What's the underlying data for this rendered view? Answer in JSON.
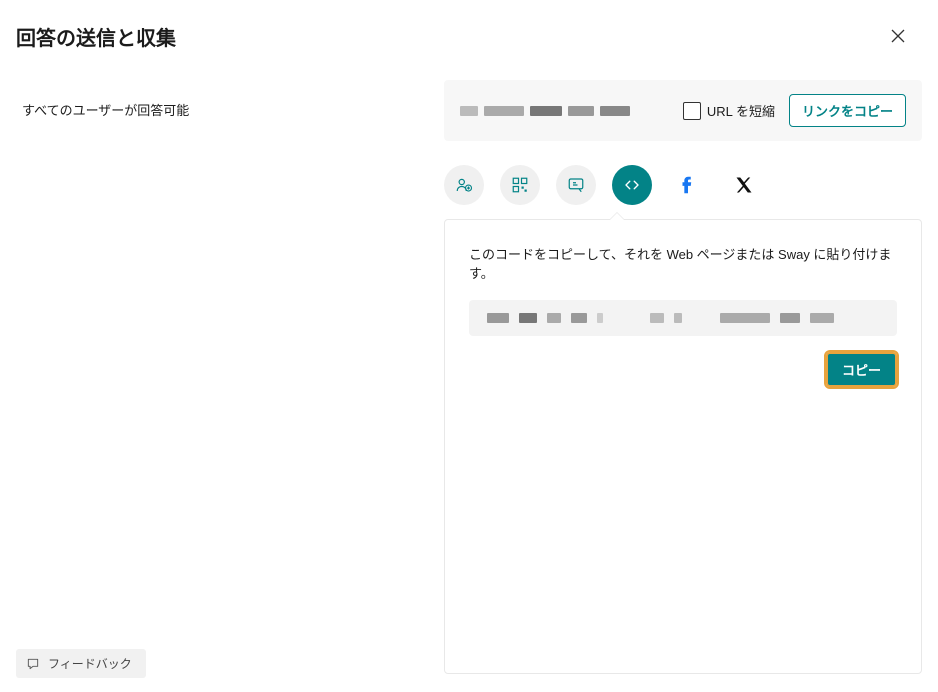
{
  "header": {
    "title": "回答の送信と収集"
  },
  "left": {
    "permission": "すべてのユーザーが回答可能"
  },
  "urlbar": {
    "shorten_label": "URL を短縮",
    "copy_link": "リンクをコピー"
  },
  "share_icons": {
    "invite": "invite-icon",
    "qr": "qr-icon",
    "teams": "teams-icon",
    "embed": "embed-icon",
    "facebook": "facebook-icon",
    "x": "x-twitter-icon"
  },
  "embed": {
    "description": "このコードをコピーして、それを Web ページまたは Sway に貼り付けます。",
    "copy": "コピー"
  },
  "feedback": {
    "label": "フィードバック"
  }
}
